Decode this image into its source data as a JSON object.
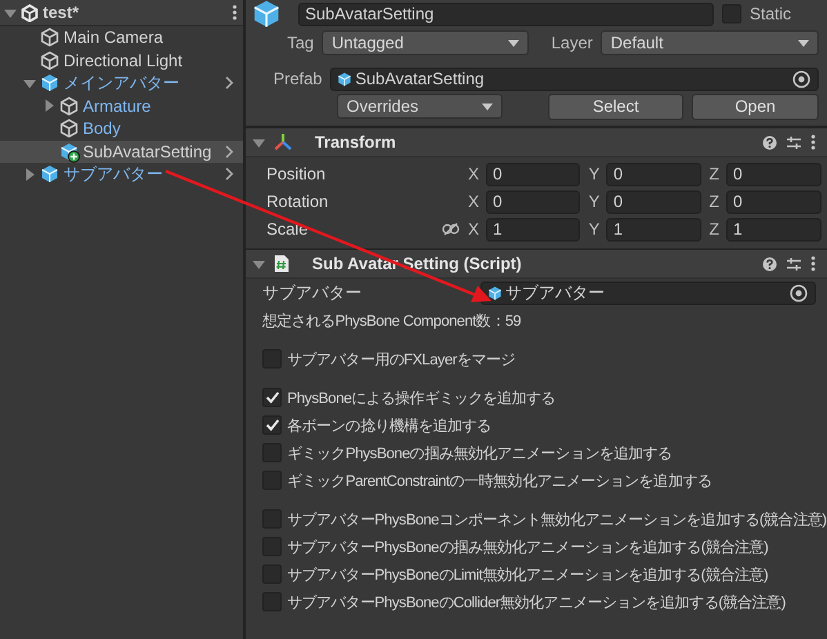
{
  "hierarchy": {
    "scene": {
      "label": "test*",
      "expanded": true
    },
    "items": [
      {
        "label": "Main Camera",
        "kind": "object",
        "selected": false
      },
      {
        "label": "Directional Light",
        "kind": "object",
        "selected": false
      },
      {
        "label": "メインアバター",
        "kind": "prefab",
        "selected": false,
        "expanded": true,
        "children": [
          {
            "label": "Armature",
            "kind": "prefab_part",
            "selected": false,
            "expanded": false
          },
          {
            "label": "Body",
            "kind": "prefab_part",
            "selected": false
          },
          {
            "label": "SubAvatarSetting",
            "kind": "added_prefab",
            "selected": true
          }
        ]
      },
      {
        "label": "サブアバター",
        "kind": "prefab",
        "selected": false,
        "expanded": false
      }
    ]
  },
  "inspector": {
    "name": "SubAvatarSetting",
    "static": false,
    "static_label": "Static",
    "tag": {
      "label": "Tag",
      "value": "Untagged"
    },
    "layer": {
      "label": "Layer",
      "value": "Default"
    },
    "prefab": {
      "label": "Prefab",
      "value": "SubAvatarSetting",
      "overrides": "Overrides",
      "buttons": [
        "Select",
        "Open"
      ]
    },
    "transform": {
      "title": "Transform",
      "expanded": true,
      "rows": [
        {
          "label": "Position",
          "linked": false,
          "values": [
            {
              "axis": "X",
              "value": "0"
            },
            {
              "axis": "Y",
              "value": "0"
            },
            {
              "axis": "Z",
              "value": "0"
            }
          ]
        },
        {
          "label": "Rotation",
          "linked": false,
          "values": [
            {
              "axis": "X",
              "value": "0"
            },
            {
              "axis": "Y",
              "value": "0"
            },
            {
              "axis": "Z",
              "value": "0"
            }
          ]
        },
        {
          "label": "Scale",
          "linked": true,
          "values": [
            {
              "axis": "X",
              "value": "1"
            },
            {
              "axis": "Y",
              "value": "1"
            },
            {
              "axis": "Z",
              "value": "1"
            }
          ]
        }
      ]
    },
    "script": {
      "title": "Sub Avatar Setting (Script)",
      "expanded": true,
      "object_field": {
        "label": "サブアバター",
        "value": "サブアバター"
      },
      "info": "想定されるPhysBone Component数：59",
      "toggle_groups": [
        [
          {
            "label": "サブアバター用のFXLayerをマージ",
            "checked": false
          }
        ],
        [
          {
            "label": "PhysBoneによる操作ギミックを追加する",
            "checked": true
          },
          {
            "label": "各ボーンの捻り機構を追加する",
            "checked": true
          },
          {
            "label": "ギミックPhysBoneの掴み無効化アニメーションを追加する",
            "checked": false
          },
          {
            "label": "ギミックParentConstraintの一時無効化アニメーションを追加する",
            "checked": false
          }
        ],
        [
          {
            "label": "サブアバターPhysBoneコンポーネント無効化アニメーションを追加する(競合注意)",
            "checked": false
          },
          {
            "label": "サブアバターPhysBoneの掴み無効化アニメーションを追加する(競合注意)",
            "checked": false
          },
          {
            "label": "サブアバターPhysBoneのLimit無効化アニメーションを追加する(競合注意)",
            "checked": false
          },
          {
            "label": "サブアバターPhysBoneのCollider無効化アニメーションを追加する(競合注意)",
            "checked": false
          }
        ]
      ]
    }
  }
}
